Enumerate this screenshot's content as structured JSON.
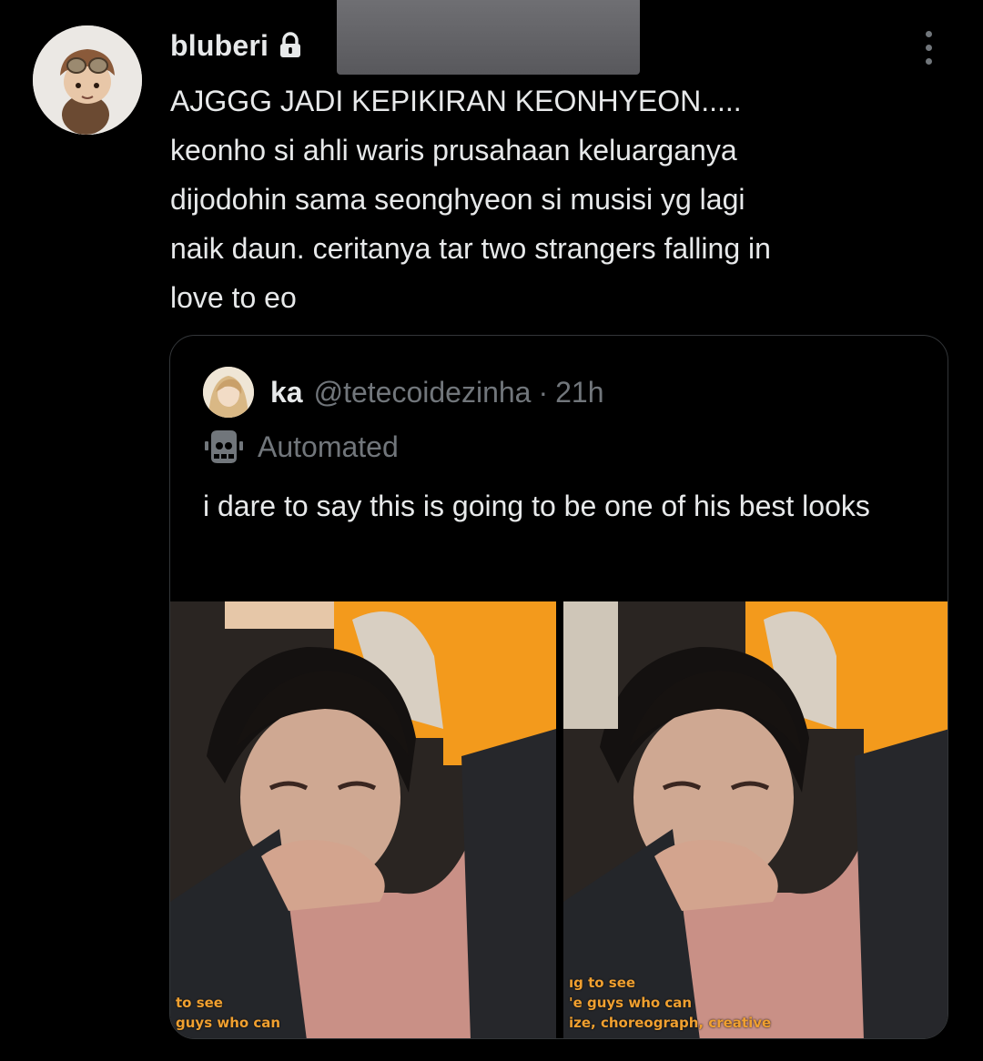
{
  "author": {
    "display_name": "bluberi",
    "protected_icon": "lock-icon"
  },
  "tweet": {
    "text": "AJGGG JADI KEPIKIRAN KEONHYEON.....\nkeonho si ahli waris prusahaan keluarganya\ndijodohin sama seonghyeon si musisi yg lagi\nnaik daun. ceritanya tar two strangers falling in\nlove to eo"
  },
  "quote": {
    "name": "ka",
    "handle": "@tetecoidezinha",
    "separator": "·",
    "time": "21h",
    "automated_label": "Automated",
    "text": "i dare to say this is going to be one of his best looks",
    "media": [
      {
        "caption_lines": [
          "to see",
          "guys who can"
        ]
      },
      {
        "caption_lines": [
          "ıg to see",
          "'e guys who can",
          "ize, choreograph, creative"
        ]
      }
    ]
  },
  "colors": {
    "background": "#000000",
    "text": "#e7e9ea",
    "secondary_text": "#71767b",
    "border": "#333639",
    "accent_orange": "#f39a1c"
  },
  "icons": [
    "lock-icon",
    "more-options-icon",
    "bot-icon"
  ]
}
